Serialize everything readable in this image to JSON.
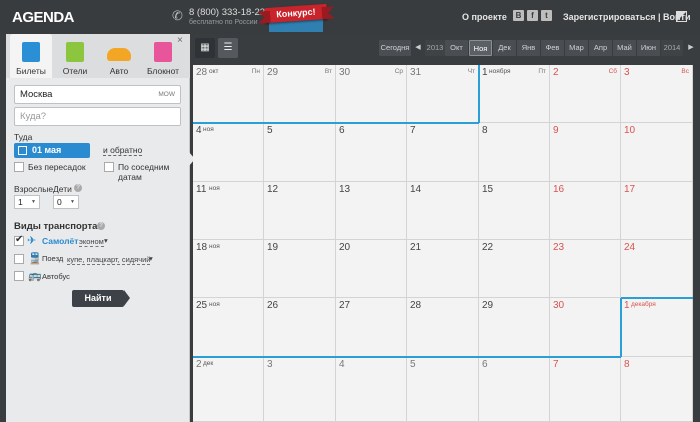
{
  "header": {
    "logo": "AGENDA",
    "phone": "8 (800) 333-18-23",
    "phone_note": "бесплатно по России",
    "contest": "Конкурс!",
    "about": "О проекте",
    "social": [
      "В",
      "f",
      "t"
    ],
    "auth": "Зарегистрироваться | Войти"
  },
  "panel": {
    "close": "×",
    "tabs": [
      {
        "label": "Билеты",
        "color": "#2b8fd6"
      },
      {
        "label": "Отели",
        "color": "#8cc63f"
      },
      {
        "label": "Авто",
        "color": "#f2a623"
      },
      {
        "label": "Блокнот",
        "color": "#e8559a"
      }
    ],
    "from_value": "Москва",
    "from_code": "MOW",
    "to_placeholder": "Куда?",
    "depart_label": "Туда",
    "depart_date": "01 мая",
    "return_link": "и обратно",
    "direct_label": "Без пересадок",
    "nearby_label": "По соседним датам",
    "adults_label": "Взрослые",
    "children_label": "Дети",
    "adults_value": "1",
    "children_value": "0",
    "transport_title": "Виды транспорта",
    "plane_label": "Самолёт",
    "plane_class": "эконом",
    "train_label": "Поезд",
    "train_classes": "купе, плацкарт, сидячий",
    "bus_label": "Автобус",
    "find": "Найти"
  },
  "toolbar": {
    "today": "Сегодня",
    "prev_year": "2013",
    "next_year": "2014",
    "months": [
      "Окт",
      "Ноя",
      "Дек",
      "Янв",
      "Фев",
      "Мар",
      "Апр",
      "Май",
      "Июн"
    ],
    "current_month": "Ноя"
  },
  "calendar": {
    "weekdays": [
      "Пн",
      "Вт",
      "Ср",
      "Чт",
      "Пт",
      "Сб",
      "Вс"
    ],
    "weeks": [
      [
        {
          "d": "28",
          "m": "окт"
        },
        {
          "d": "29"
        },
        {
          "d": "30"
        },
        {
          "d": "31"
        },
        {
          "d": "1",
          "m": "ноября"
        },
        {
          "d": "2"
        },
        {
          "d": "3"
        }
      ],
      [
        {
          "d": "4",
          "m": "ноя"
        },
        {
          "d": "5"
        },
        {
          "d": "6"
        },
        {
          "d": "7"
        },
        {
          "d": "8"
        },
        {
          "d": "9"
        },
        {
          "d": "10"
        }
      ],
      [
        {
          "d": "11",
          "m": "ноя"
        },
        {
          "d": "12"
        },
        {
          "d": "13"
        },
        {
          "d": "14"
        },
        {
          "d": "15"
        },
        {
          "d": "16"
        },
        {
          "d": "17"
        }
      ],
      [
        {
          "d": "18",
          "m": "ноя"
        },
        {
          "d": "19"
        },
        {
          "d": "20"
        },
        {
          "d": "21"
        },
        {
          "d": "22"
        },
        {
          "d": "23"
        },
        {
          "d": "24"
        }
      ],
      [
        {
          "d": "25",
          "m": "ноя"
        },
        {
          "d": "26"
        },
        {
          "d": "27"
        },
        {
          "d": "28"
        },
        {
          "d": "29"
        },
        {
          "d": "30"
        },
        {
          "d": "1",
          "m": "декабря"
        }
      ],
      [
        {
          "d": "2",
          "m": "дек"
        },
        {
          "d": "3"
        },
        {
          "d": "4"
        },
        {
          "d": "5"
        },
        {
          "d": "6"
        },
        {
          "d": "7"
        },
        {
          "d": "8"
        }
      ]
    ],
    "accent": "#2a9fd6",
    "weekend_color": "#d9534f"
  }
}
